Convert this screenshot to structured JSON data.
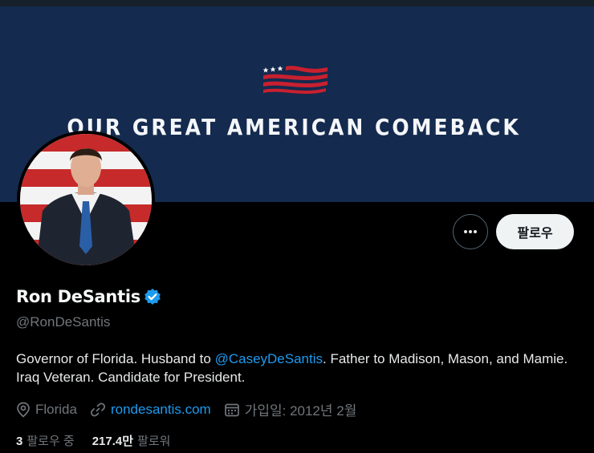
{
  "banner": {
    "text": "OUR GREAT AMERICAN COMEBACK",
    "logo_icon": "american-flag-icon"
  },
  "profile": {
    "display_name": "Ron DeSantis",
    "verified_icon": "verified-badge-icon",
    "handle": "@RonDeSantis",
    "bio_part1": "Governor of Florida. Husband to ",
    "bio_mention": "@CaseyDeSantis",
    "bio_part2": ". Father to Madison, Mason, and Mamie. Iraq Veteran. Candidate for President.",
    "location": "Florida",
    "website": "rondesantis.com",
    "joined": "가입일: 2012년 2월"
  },
  "actions": {
    "more_icon": "more-horizontal-icon",
    "follow_label": "팔로우"
  },
  "stats": {
    "following_count": "3",
    "following_label": "팔로우 중",
    "followers_count": "217.4만",
    "followers_label": "팔로워"
  },
  "colors": {
    "banner_bg": "#142a4e",
    "link": "#1d9bf0",
    "secondary_text": "#71767b",
    "follow_button_bg": "#eff3f4"
  }
}
